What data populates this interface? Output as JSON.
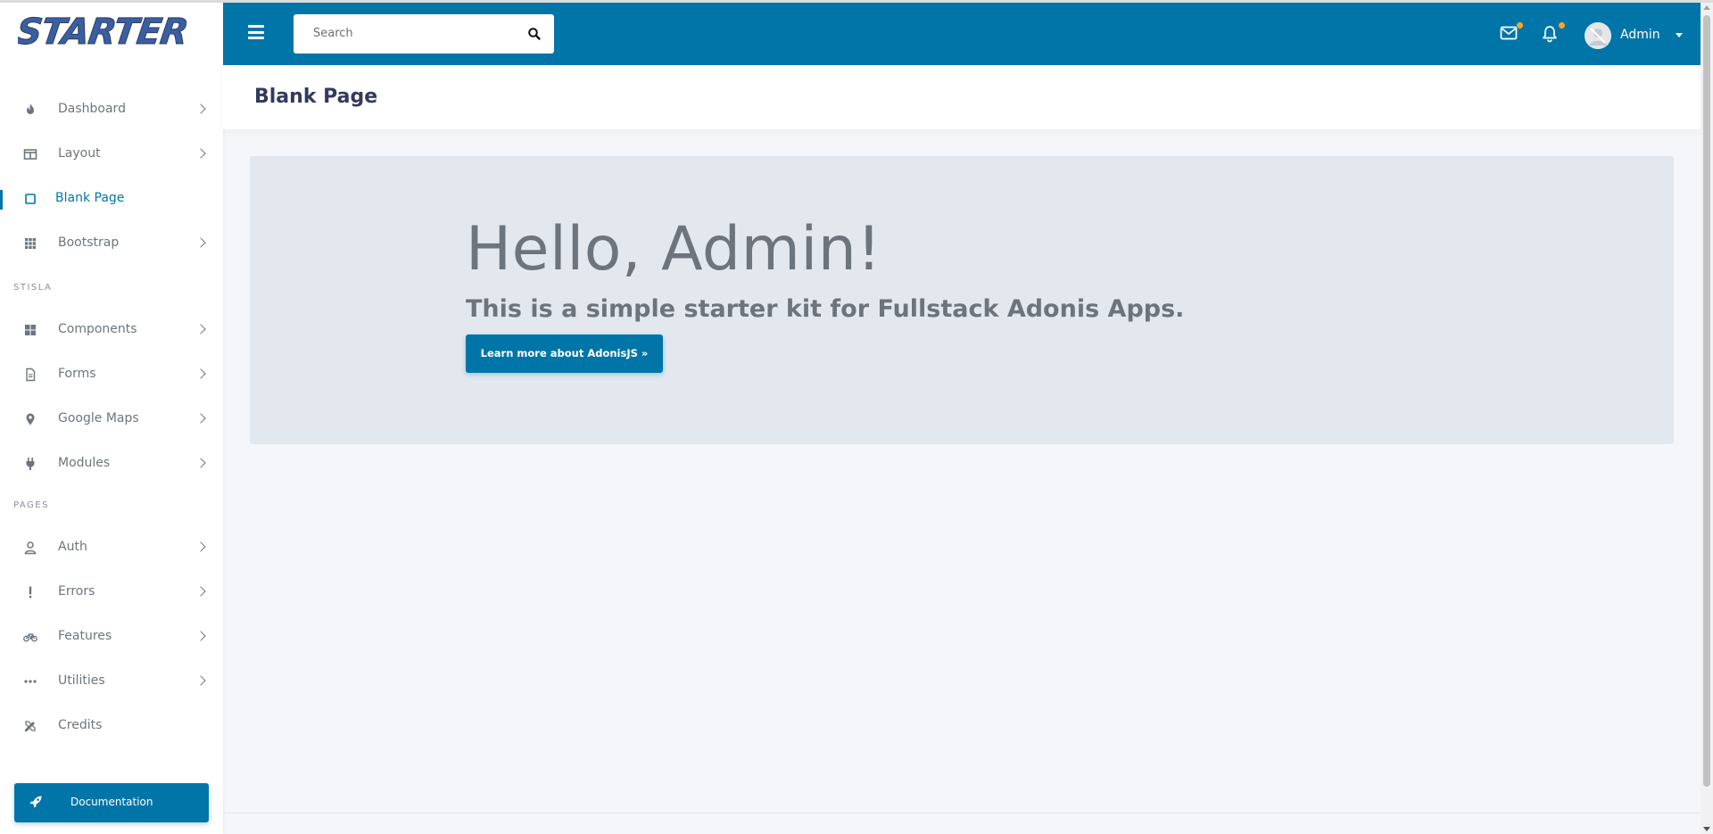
{
  "brand": {
    "logo_text": "STARTER"
  },
  "colors": {
    "primary": "#0275a8",
    "sidebar_text": "#6c757d",
    "heading": "#34395e",
    "beep": "#ffa426"
  },
  "navbar": {
    "menu_icon": "hamburger-icon",
    "search": {
      "placeholder": "Search",
      "value": "",
      "icon": "search-icon"
    },
    "messages_icon": "envelope-icon",
    "notifications_icon": "bell-icon",
    "user": {
      "name": "Admin"
    }
  },
  "sidebar": {
    "items": [
      {
        "label": "Dashboard",
        "icon": "fire-icon"
      },
      {
        "label": "Layout",
        "icon": "columns-icon"
      },
      {
        "label": "Blank Page",
        "icon": "square-icon",
        "active": true
      },
      {
        "label": "Bootstrap",
        "icon": "grid-icon"
      },
      {
        "label": "Components",
        "icon": "th-large-icon"
      },
      {
        "label": "Forms",
        "icon": "file-icon"
      },
      {
        "label": "Google Maps",
        "icon": "map-marker-icon"
      },
      {
        "label": "Modules",
        "icon": "plug-icon"
      },
      {
        "label": "Auth",
        "icon": "user-icon"
      },
      {
        "label": "Errors",
        "icon": "exclamation-icon"
      },
      {
        "label": "Features",
        "icon": "bicycle-icon"
      },
      {
        "label": "Utilities",
        "icon": "ellipsis-icon"
      },
      {
        "label": "Credits",
        "icon": "pencil-ruler-icon"
      }
    ],
    "headers": {
      "stisla": "STISLA",
      "pages": "PAGES"
    },
    "documentation": {
      "label": "Documentation",
      "icon": "rocket-icon"
    }
  },
  "main": {
    "title": "Blank Page",
    "jumbotron": {
      "heading": "Hello, Admin!",
      "lead": "This is a simple starter kit for Fullstack Adonis Apps.",
      "button": "Learn more about AdonisJS »"
    }
  }
}
